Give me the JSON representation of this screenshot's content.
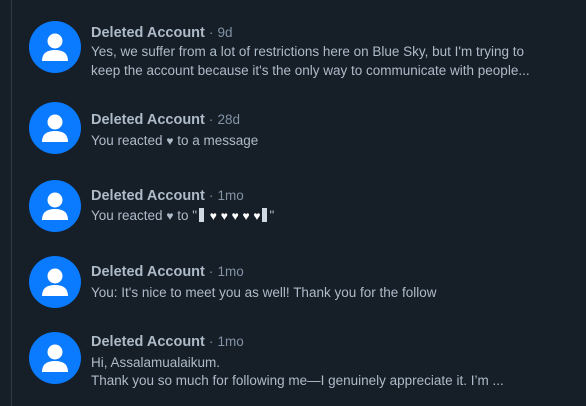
{
  "conversations": [
    {
      "name": "Deleted Account",
      "separator": "·",
      "time": "9d",
      "lines": [
        "Yes, we suffer from a lot of restrictions here on Blue Sky, but I'm trying to",
        "keep the account because it's the only way to communicate with people..."
      ]
    },
    {
      "name": "Deleted Account",
      "separator": "·",
      "time": "28d",
      "reaction_prefix": "You reacted",
      "reaction_suffix": "to a message"
    },
    {
      "name": "Deleted Account",
      "separator": "·",
      "time": "1mo",
      "reaction_prefix": "You reacted",
      "reaction_to": "to \"",
      "reaction_end": "\""
    },
    {
      "name": "Deleted Account",
      "separator": "·",
      "time": "1mo",
      "lines": [
        "You: It's nice to meet you as well! Thank you for the follow"
      ]
    },
    {
      "name": "Deleted Account",
      "separator": "·",
      "time": "1mo",
      "lines": [
        "Hi, Assalamualaikum.",
        "Thank you so much for following me—I genuinely appreciate it. I’m ..."
      ]
    }
  ],
  "icons": {
    "avatar": "default-user-avatar-icon",
    "heart": "heart-icon"
  },
  "colors": {
    "background": "#161e27",
    "avatar": "#0a7aff",
    "name_text": "#aebbc9",
    "meta_text": "#8293a6"
  }
}
